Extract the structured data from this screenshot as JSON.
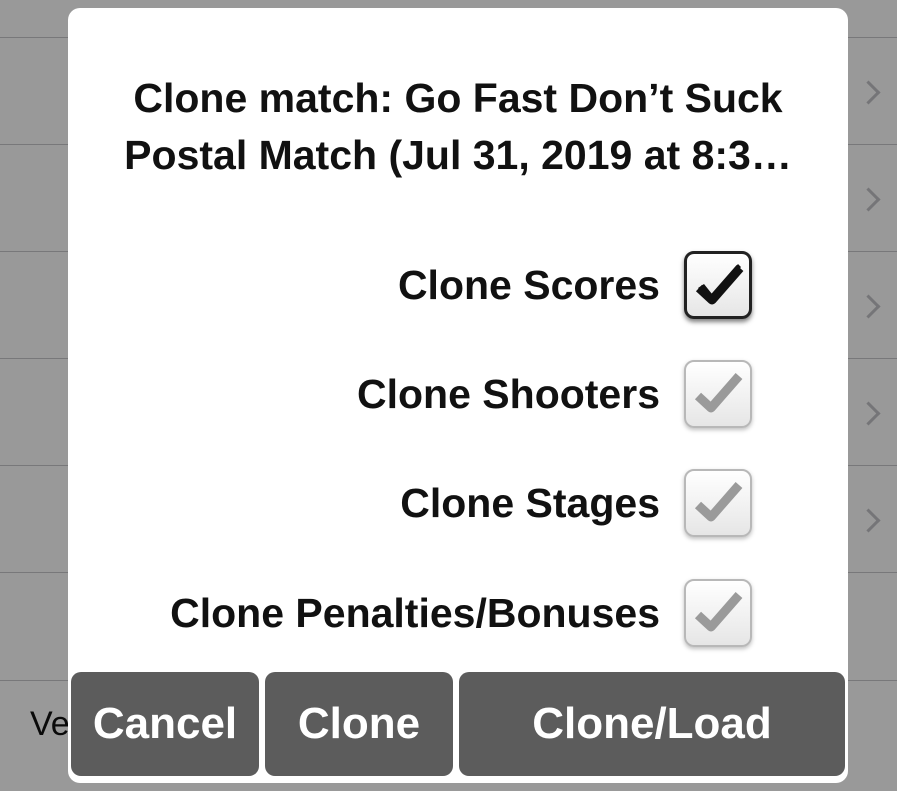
{
  "background": {
    "bottom_text": "Ve"
  },
  "dialog": {
    "title_line1": "Clone match: Go Fast Don’t Suck",
    "title_line2": "Postal Match (Jul 31, 2019 at 8:3…",
    "options": [
      {
        "label": "Clone Scores",
        "checked": true,
        "style": "active"
      },
      {
        "label": "Clone Shooters",
        "checked": true,
        "style": "disabled"
      },
      {
        "label": "Clone Stages",
        "checked": true,
        "style": "disabled"
      },
      {
        "label": "Clone Penalties/Bonuses",
        "checked": true,
        "style": "disabled"
      }
    ],
    "buttons": {
      "cancel": "Cancel",
      "clone": "Clone",
      "clone_load": "Clone/Load"
    }
  },
  "colors": {
    "button_bg": "#5c5c5c",
    "check_active": "#111111",
    "check_disabled": "#9a9a9a"
  }
}
